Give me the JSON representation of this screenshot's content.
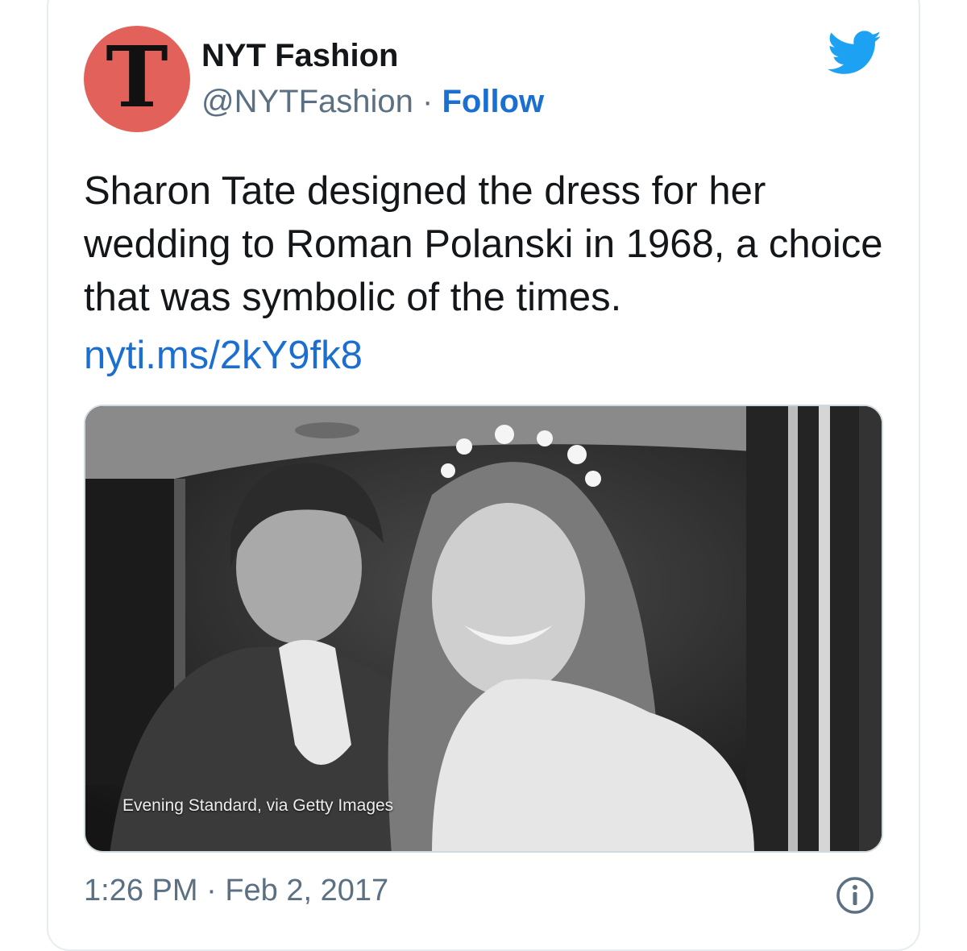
{
  "account": {
    "avatar_glyph": "T",
    "avatar_color": "#e2625b",
    "display_name": "NYT Fashion",
    "handle": "@NYTFashion",
    "separator": "·",
    "follow_label": "Follow"
  },
  "tweet": {
    "text": "Sharon Tate designed the dress for her wedding to Roman Polanski in 1968, a choice that was symbolic of the times.",
    "link": "nyti.ms/2kY9fk8"
  },
  "media": {
    "caption": "Evening Standard, via Getty Images"
  },
  "footer": {
    "time": "1:26 PM",
    "separator": "·",
    "date": "Feb 2, 2017"
  },
  "icons": {
    "brand": "twitter-bird-icon",
    "info": "info-icon"
  },
  "colors": {
    "link": "#1b6fd0",
    "twitter_blue": "#1da1f2",
    "muted": "#5b7083"
  }
}
